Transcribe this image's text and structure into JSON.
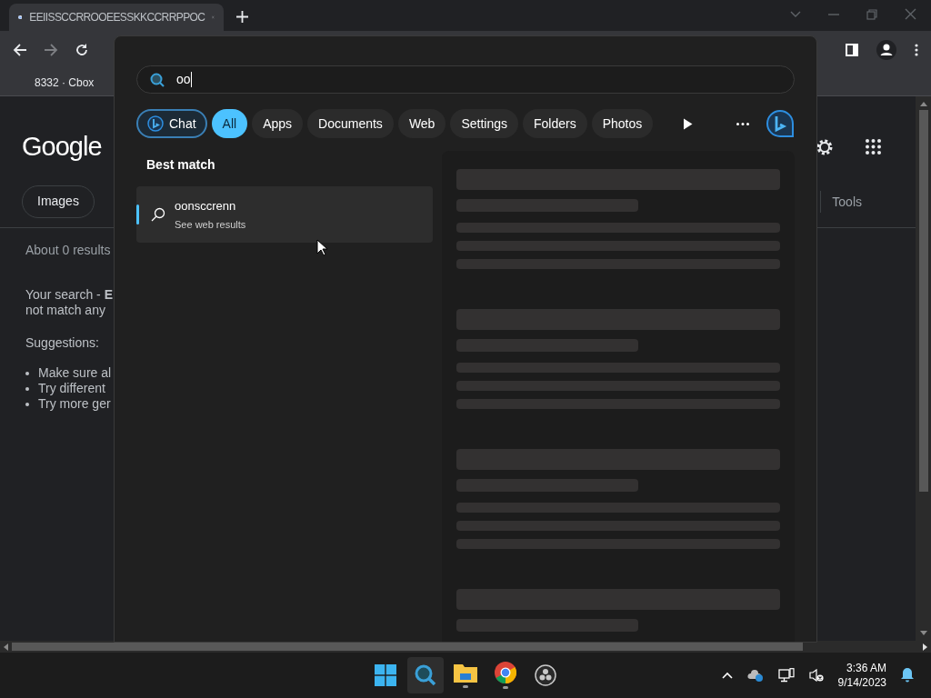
{
  "browser": {
    "tab": {
      "title": "EEIISSCCRROOEESSKKCCRRPPOC",
      "selected": true
    },
    "bookmark": "8332 · Cbox"
  },
  "page": {
    "logo": "Google",
    "chips": [
      "Images"
    ],
    "tools": "Tools",
    "result_stats": "About 0 results",
    "message": [
      "Your search - **E**",
      "not match any"
    ],
    "suggestions_title": "Suggestions:",
    "suggestions": [
      "Make sure al",
      "Try different",
      "Try more ger"
    ]
  },
  "search_panel": {
    "query": "oo",
    "filters": [
      {
        "label": "Chat",
        "kind": "chat",
        "selected": false
      },
      {
        "label": "All",
        "kind": "filter",
        "selected": true
      },
      {
        "label": "Apps",
        "kind": "filter",
        "selected": false
      },
      {
        "label": "Documents",
        "kind": "filter",
        "selected": false
      },
      {
        "label": "Web",
        "kind": "filter",
        "selected": false
      },
      {
        "label": "Settings",
        "kind": "filter",
        "selected": false
      },
      {
        "label": "Folders",
        "kind": "filter",
        "selected": false
      },
      {
        "label": "Photos",
        "kind": "filter",
        "selected": false
      }
    ],
    "section_title": "Best match",
    "best_match": {
      "title": "oonsccrenn",
      "subtitle": "See web results",
      "selected": true
    }
  },
  "taskbar": {
    "time": "3:36 AM",
    "date": "9/14/2023"
  }
}
